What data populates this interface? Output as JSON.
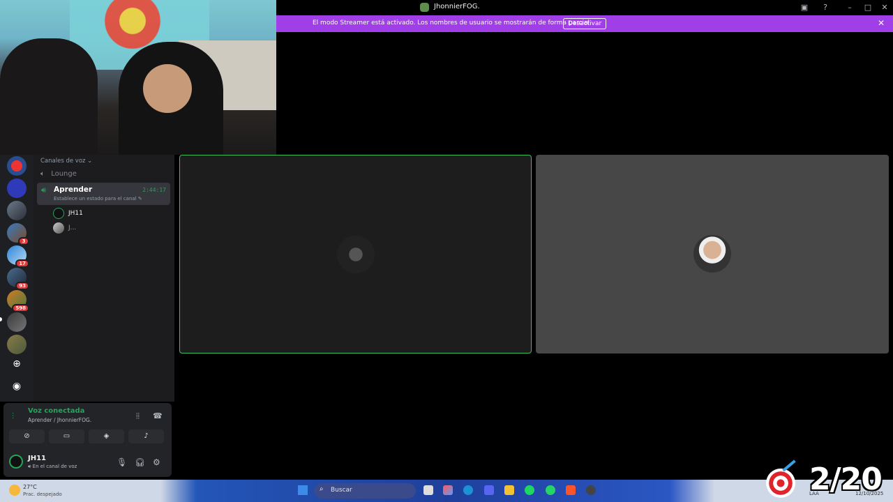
{
  "window": {
    "title": "JhonnierFOG."
  },
  "streamer_banner": {
    "message": "El modo Streamer está activado. Los nombres de usuario se mostrarán de forma parcial.",
    "button": "Desactivar"
  },
  "server_rail": {
    "servers": [
      {
        "badge": ""
      },
      {
        "badge": ""
      },
      {
        "badge": ""
      },
      {
        "badge": "3"
      },
      {
        "badge": "17"
      },
      {
        "badge": "93"
      },
      {
        "badge": "598"
      },
      {
        "badge": ""
      },
      {
        "badge": ""
      }
    ]
  },
  "sidebar": {
    "category": "Canales de voz",
    "channels": [
      {
        "name": "Lounge"
      }
    ],
    "active_channel": {
      "name": "Aprender",
      "timer": "2:44:17",
      "status": "Establece un estado para el canal"
    },
    "members": [
      {
        "name": "JH11"
      },
      {
        "name": "J..."
      }
    ]
  },
  "voice_panel": {
    "title": "Voz conectada",
    "subtitle": "Aprender / JhonnierFOG."
  },
  "user_bar": {
    "username": "JH11",
    "status": "En el canal de voz"
  },
  "taskbar": {
    "temperature": "27°C",
    "condition": "Prac. despejado",
    "search_placeholder": "Buscar",
    "lang": "LAA",
    "date": "12/10/2025"
  },
  "score_overlay": {
    "score": "2/20"
  },
  "colors": {
    "accent_green": "#23a55a",
    "streamer_purple": "#a03ee7",
    "speaking_border": "#3fbf5b",
    "badge_red": "#e03b3b"
  },
  "icons": [
    "app-icon",
    "inbox-icon",
    "help-icon",
    "minimize-icon",
    "maximize-icon",
    "close-icon",
    "speaker-icon",
    "pencil-icon",
    "signal-icon",
    "soundwave-icon",
    "hangup-icon",
    "camera-off-icon",
    "screen-share-icon",
    "activity-icon",
    "soundboard-icon",
    "mic-icon",
    "headphones-icon",
    "gear-icon",
    "add-server-icon",
    "discover-icon",
    "search-icon",
    "weather-icon",
    "start-icon",
    "target-icon"
  ]
}
